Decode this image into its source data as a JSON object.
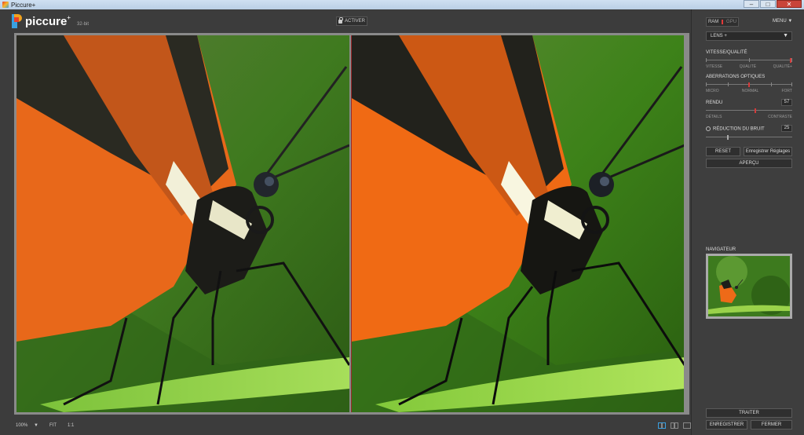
{
  "window": {
    "title": "Piccure+",
    "controls": {
      "minimize": "–",
      "maximize": "□",
      "close": "✕"
    }
  },
  "app": {
    "logo_text": "piccure",
    "logo_sup": "+",
    "bit_label": "32-bit",
    "activate_label": "ACTIVER"
  },
  "panel": {
    "ram_label": "RAM",
    "gpu_label": "GPU",
    "menu_label": "MENU ▼",
    "lens_value": "LENS +",
    "lens_arrow": "▼",
    "speed_quality": {
      "title": "VITESSE/QUALITÉ",
      "left": "VITESSE",
      "middle": "QUALITÉ",
      "right": "QUALITÉ+",
      "value_fraction": 0.98
    },
    "aberrations": {
      "title": "ABERRATIONS OPTIQUES",
      "left": "MICRO",
      "middle": "NORMAL",
      "right": "FORT",
      "value_fraction": 0.5
    },
    "rendering": {
      "title": "RENDU",
      "value": "57",
      "left": "DÉTAILS",
      "right": "CONTRASTE",
      "value_fraction": 0.57
    },
    "noise": {
      "title": "RÉDUCTION DU BRUIT",
      "value": "25",
      "value_fraction": 0.25
    },
    "reset_label": "RESET",
    "save_settings_label": "Enregistrer Réglages",
    "preview_label": "APERÇU",
    "navigator_label": "NAVIGATEUR",
    "process_label": "TRAITER",
    "save_label": "ENREGISTRER",
    "close_label": "FERMER"
  },
  "bottombar": {
    "zoom_value": "100%",
    "zoom_arrow": "▼",
    "fit_label": "FIT",
    "one_to_one_label": "1:1"
  },
  "colors": {
    "accent_red": "#d43b3b",
    "accent_blue": "#3aa0e0",
    "background": "#3c3c3c"
  }
}
